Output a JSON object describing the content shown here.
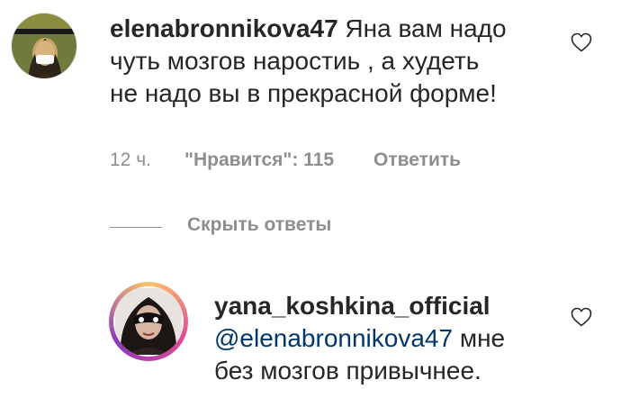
{
  "comment": {
    "username": "elenabronnikova47",
    "text": " Яна вам надо чуть мозгов наростиь , а худеть не надо вы в прекрасной форме!",
    "line1": " Яна вам надо",
    "line2": "чуть мозгов наростиь , а худеть",
    "line3": "не надо вы в прекрасной форме!",
    "time": "12 ч.",
    "likes": "\"Нравится\": 115",
    "reply_label": "Ответить",
    "avatar_icon": "mona-lisa-mask-avatar"
  },
  "replies_toggle": {
    "label": "Скрыть ответы"
  },
  "reply": {
    "username": "yana_koshkina_official",
    "mention": "@elenabronnikova47",
    "line1_rest": " мне",
    "line2": "без мозгов привычнее.",
    "avatar_icon": "woman-mask-avatar"
  },
  "icons": {
    "like": "heart-outline-icon"
  },
  "colors": {
    "text": "#262626",
    "meta": "#8e8e8e",
    "mention": "#00376b"
  }
}
